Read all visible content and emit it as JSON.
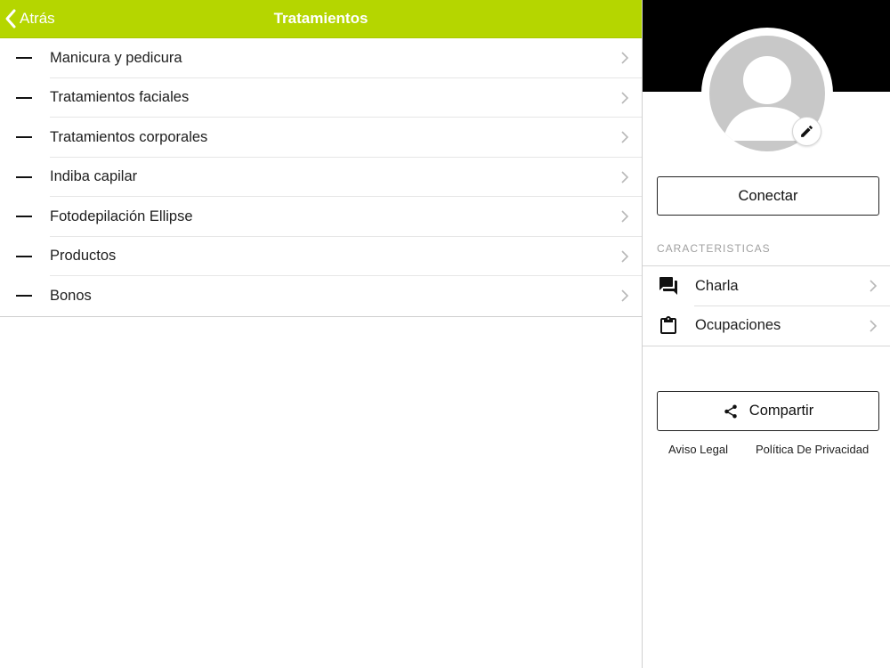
{
  "navbar": {
    "back_label": "Atrás",
    "title": "Tratamientos",
    "color": "#b5d600"
  },
  "treatments": {
    "items": [
      {
        "label": "Manicura y pedicura"
      },
      {
        "label": "Tratamientos faciales"
      },
      {
        "label": "Tratamientos corporales"
      },
      {
        "label": "Indiba capilar"
      },
      {
        "label": "Fotodepilación Ellipse"
      },
      {
        "label": "Productos"
      },
      {
        "label": "Bonos"
      }
    ]
  },
  "profile": {
    "avatar_icon": "user-silhouette-icon",
    "edit_icon": "pencil-icon",
    "connect_label": "Conectar",
    "section_label": "CARACTERISTICAS",
    "features": [
      {
        "label": "Charla",
        "icon": "chat-bubbles-icon"
      },
      {
        "label": "Ocupaciones",
        "icon": "clipboard-icon"
      }
    ],
    "share_label": "Compartir",
    "share_icon": "share-icon",
    "legal_label": "Aviso Legal",
    "privacy_label": "Política De Privacidad"
  }
}
